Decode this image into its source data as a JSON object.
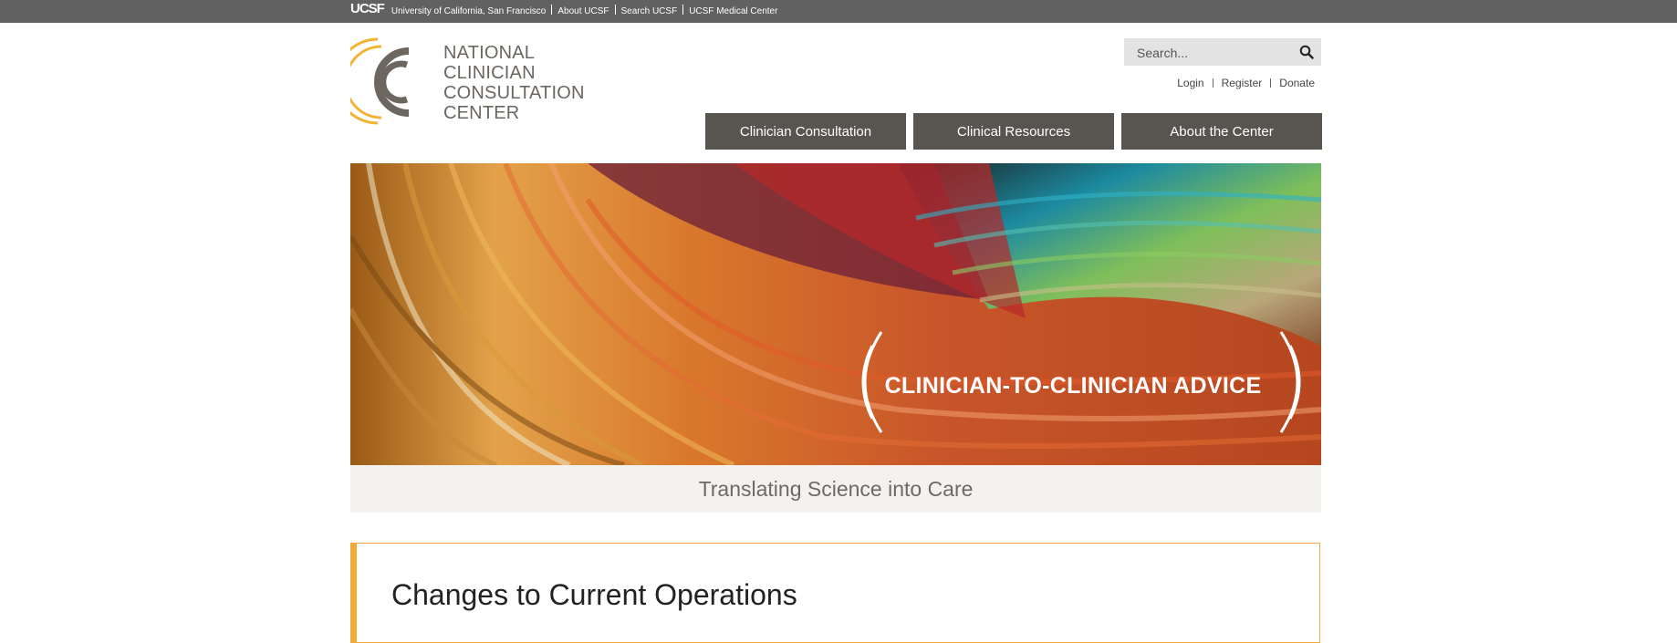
{
  "ucsf_bar": {
    "logo": "UCSF",
    "links": [
      "University of California, San Francisco",
      "About UCSF",
      "Search UCSF",
      "UCSF Medical Center"
    ]
  },
  "logo": {
    "lines": [
      "NATIONAL",
      "CLINICIAN",
      "CONSULTATION",
      "CENTER"
    ]
  },
  "search": {
    "placeholder": "Search..."
  },
  "util_links": [
    "Login",
    "Register",
    "Donate"
  ],
  "nav": [
    "Clinician Consultation",
    "Clinical Resources",
    "About the Center"
  ],
  "hero": {
    "headline": "CLINICIAN-TO-CLINICIAN ADVICE"
  },
  "tagline": "Translating Science into Care",
  "notice": {
    "title": "Changes to Current Operations"
  },
  "colors": {
    "top_bar": "#616161",
    "nav": "#58544f",
    "accent": "#f2a93b",
    "logo_gray": "#6b6660"
  }
}
